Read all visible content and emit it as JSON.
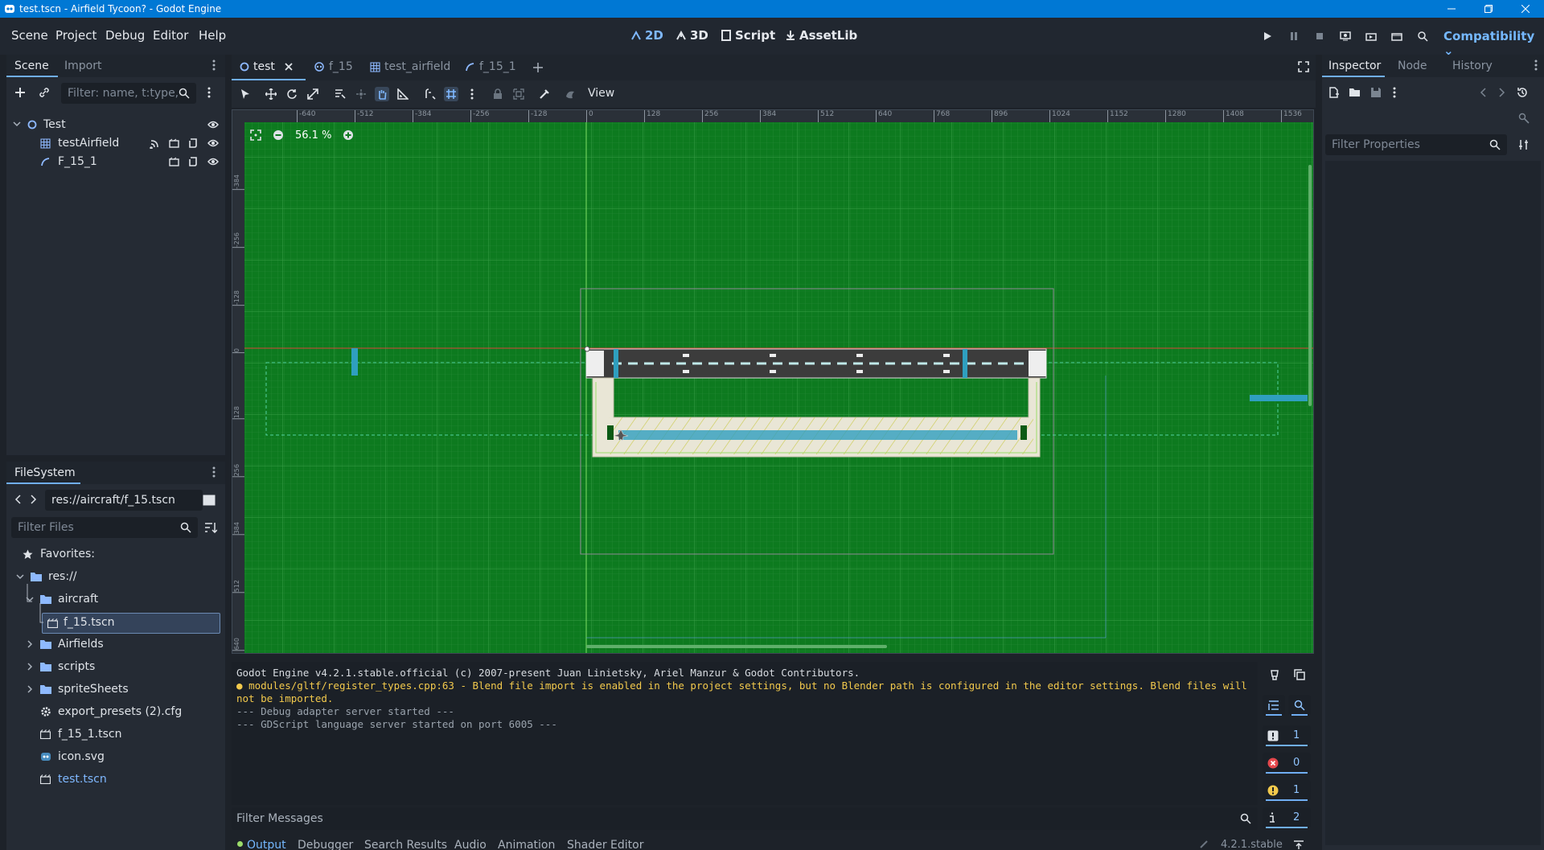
{
  "window": {
    "title": "test.tscn - Airfield Tycoon? - Godot Engine"
  },
  "menu": [
    "Scene",
    "Project",
    "Debug",
    "Editor",
    "Help"
  ],
  "modes": {
    "m2d": "2D",
    "m3d": "3D",
    "script": "Script",
    "assetlib": "AssetLib"
  },
  "renderer": "Compatibility",
  "scene_dock": {
    "tabs": [
      "Scene",
      "Import"
    ],
    "filter_placeholder": "Filter: name, t:type,",
    "nodes": [
      {
        "label": "Test",
        "icon": "node2d-icon"
      },
      {
        "label": "testAirfield",
        "icon": "tilemap-icon"
      },
      {
        "label": "F_15_1",
        "icon": "path-icon"
      }
    ]
  },
  "filesystem": {
    "title": "FileSystem",
    "path": "res://aircraft/f_15.tscn",
    "filter_placeholder": "Filter Files",
    "favorites": "Favorites:",
    "items": [
      {
        "label": "res://",
        "icon": "folder-icon"
      },
      {
        "label": "aircraft",
        "icon": "folder-icon"
      },
      {
        "label": "f_15.tscn",
        "icon": "scene-file-icon"
      },
      {
        "label": "Airfields",
        "icon": "folder-icon"
      },
      {
        "label": "scripts",
        "icon": "folder-icon"
      },
      {
        "label": "spriteSheets",
        "icon": "folder-icon"
      },
      {
        "label": "export_presets (2).cfg",
        "icon": "gear-file-icon"
      },
      {
        "label": "f_15_1.tscn",
        "icon": "scene-file-icon"
      },
      {
        "label": "icon.svg",
        "icon": "image-file-icon"
      },
      {
        "label": "test.tscn",
        "icon": "scene-file-icon"
      }
    ]
  },
  "scene_tabs": [
    "test",
    "f_15",
    "test_airfield",
    "f_15_1"
  ],
  "toolbar": {
    "view": "View"
  },
  "viewport": {
    "zoom": "56.1 %",
    "ruler_top": [
      "-640",
      "-512",
      "-384",
      "-256",
      "-128",
      "0",
      "128",
      "256",
      "384",
      "512",
      "640",
      "768",
      "896",
      "1024",
      "1152",
      "1280",
      "1408",
      "1536"
    ],
    "ruler_left": [
      "-384",
      "-256",
      "-128",
      "0",
      "128",
      "256",
      "384",
      "512",
      "640"
    ],
    "colors": {
      "ground": "#0d7a1f",
      "runway": "#3c3c3c",
      "taxiway": "#e9e6d6"
    }
  },
  "inspector": {
    "tabs": [
      "Inspector",
      "Node",
      "History"
    ],
    "filter_placeholder": "Filter Properties"
  },
  "output": {
    "lines": [
      {
        "type": "normal",
        "text": "Godot Engine v4.2.1.stable.official (c) 2007-present Juan Linietsky, Ariel Manzur & Godot Contributors."
      },
      {
        "type": "warn",
        "text": "modules/gltf/register_types.cpp:63 - Blend file import is enabled in the project settings, but no Blender path is configured in the editor settings. Blend files will not be imported."
      },
      {
        "type": "dim",
        "text": "--- Debug adapter server started ---"
      },
      {
        "type": "dim",
        "text": "--- GDScript language server started on port 6005 ---"
      }
    ],
    "filter_placeholder": "Filter Messages",
    "counts": {
      "messages": "1",
      "errors": "0",
      "warnings": "1",
      "info": "2"
    }
  },
  "bottom_tabs": [
    "Output",
    "Debugger",
    "Search Results",
    "Audio",
    "Animation",
    "Shader Editor"
  ],
  "version": "4.2.1.stable"
}
